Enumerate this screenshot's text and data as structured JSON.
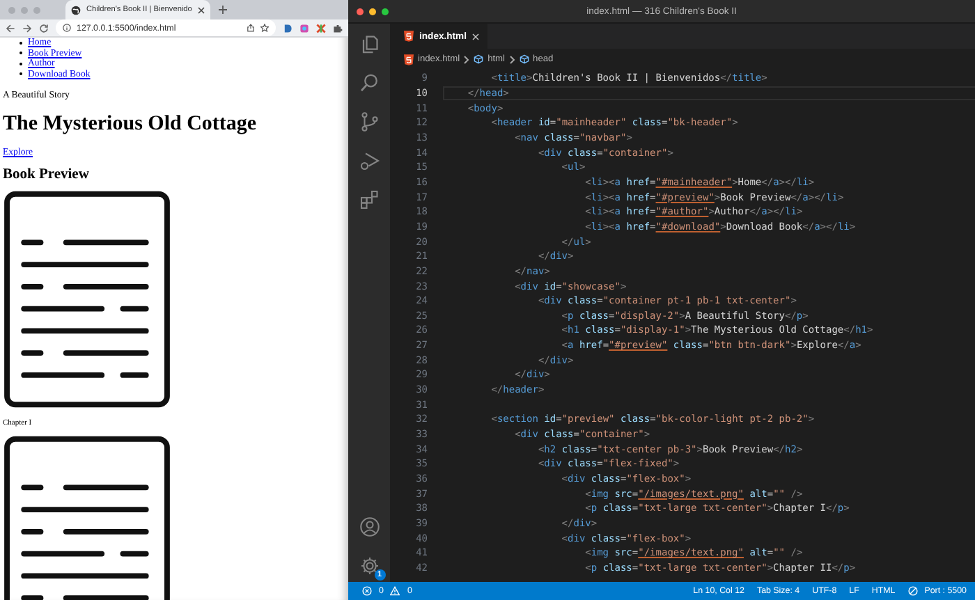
{
  "browser": {
    "tab": {
      "title": "Children's Book II | Bienvenido"
    },
    "address": "127.0.0.1:5500/index.html",
    "page": {
      "nav_links": [
        "Home",
        "Book Preview",
        "Author",
        "Download Book"
      ],
      "tagline": "A Beautiful Story",
      "heading": "The Mysterious Old Cottage",
      "explore_link": "Explore",
      "section_heading": "Book Preview",
      "previews": [
        {
          "kind": "image"
        },
        {
          "kind": "caption",
          "text": "Chapter I"
        },
        {
          "kind": "image"
        }
      ]
    }
  },
  "editor": {
    "title": "index.html — 316 Children's Book II",
    "tab": {
      "label": "index.html"
    },
    "breadcrumb": [
      "index.html",
      "html",
      "head"
    ],
    "lines": [
      {
        "number": "9",
        "code": "        <title>Children's Book II | Bienvenidos</title>",
        "current": false
      },
      {
        "number": "10",
        "code": "    </head>",
        "current": true
      },
      {
        "number": "11",
        "code": "    <body>",
        "current": false
      },
      {
        "number": "12",
        "code": "        <header id=\"mainheader\" class=\"bk-header\">",
        "current": false
      },
      {
        "number": "13",
        "code": "            <nav class=\"navbar\">",
        "current": false
      },
      {
        "number": "14",
        "code": "                <div class=\"container\">",
        "current": false
      },
      {
        "number": "15",
        "code": "                    <ul>",
        "current": false
      },
      {
        "number": "16",
        "code": "                        <li><a href=\"#mainheader\">Home</a></li>",
        "current": false
      },
      {
        "number": "17",
        "code": "                        <li><a href=\"#preview\">Book Preview</a></li>",
        "current": false
      },
      {
        "number": "18",
        "code": "                        <li><a href=\"#author\">Author</a></li>",
        "current": false
      },
      {
        "number": "19",
        "code": "                        <li><a href=\"#download\">Download Book</a></li>",
        "current": false
      },
      {
        "number": "20",
        "code": "                    </ul>",
        "current": false
      },
      {
        "number": "21",
        "code": "                </div>",
        "current": false
      },
      {
        "number": "22",
        "code": "            </nav>",
        "current": false
      },
      {
        "number": "23",
        "code": "            <div id=\"showcase\">",
        "current": false
      },
      {
        "number": "24",
        "code": "                <div class=\"container pt-1 pb-1 txt-center\">",
        "current": false
      },
      {
        "number": "25",
        "code": "                    <p class=\"display-2\">A Beautiful Story</p>",
        "current": false
      },
      {
        "number": "26",
        "code": "                    <h1 class=\"display-1\">The Mysterious Old Cottage</h1>",
        "current": false
      },
      {
        "number": "27",
        "code": "                    <a href=\"#preview\" class=\"btn btn-dark\">Explore</a>",
        "current": false
      },
      {
        "number": "28",
        "code": "                </div>",
        "current": false
      },
      {
        "number": "29",
        "code": "            </div>",
        "current": false
      },
      {
        "number": "30",
        "code": "        </header>",
        "current": false
      },
      {
        "number": "31",
        "current": false
      },
      {
        "number": "32",
        "code": "        <section id=\"preview\" class=\"bk-color-light pt-2 pb-2\">",
        "current": false
      },
      {
        "number": "33",
        "code": "            <div class=\"container\">",
        "current": false
      },
      {
        "number": "34",
        "code": "                <h2 class=\"txt-center pb-3\">Book Preview</h2>",
        "current": false
      },
      {
        "number": "35",
        "code": "                <div class=\"flex-fixed\">",
        "current": false
      },
      {
        "number": "36",
        "code": "                    <div class=\"flex-box\">",
        "current": false
      },
      {
        "number": "37",
        "code": "                        <img src=\"/images/text.png\" alt=\"\" />",
        "current": false
      },
      {
        "number": "38",
        "code": "                        <p class=\"txt-large txt-center\">Chapter I</p>",
        "current": false
      },
      {
        "number": "39",
        "code": "                    </div>",
        "current": false
      },
      {
        "number": "40",
        "code": "                    <div class=\"flex-box\">",
        "current": false
      },
      {
        "number": "41",
        "code": "                        <img src=\"/images/text.png\" alt=\"\" />",
        "current": false
      },
      {
        "number": "42",
        "code": "                        <p class=\"txt-large txt-center\">Chapter II</p>",
        "current": false
      }
    ],
    "settings_badge": "1",
    "status_bar": {
      "errors": "0",
      "warnings": "0",
      "items": [
        "Ln 10, Col 12",
        "Tab Size: 4",
        "UTF-8",
        "LF",
        "HTML"
      ],
      "port": "Port : 5500"
    }
  }
}
